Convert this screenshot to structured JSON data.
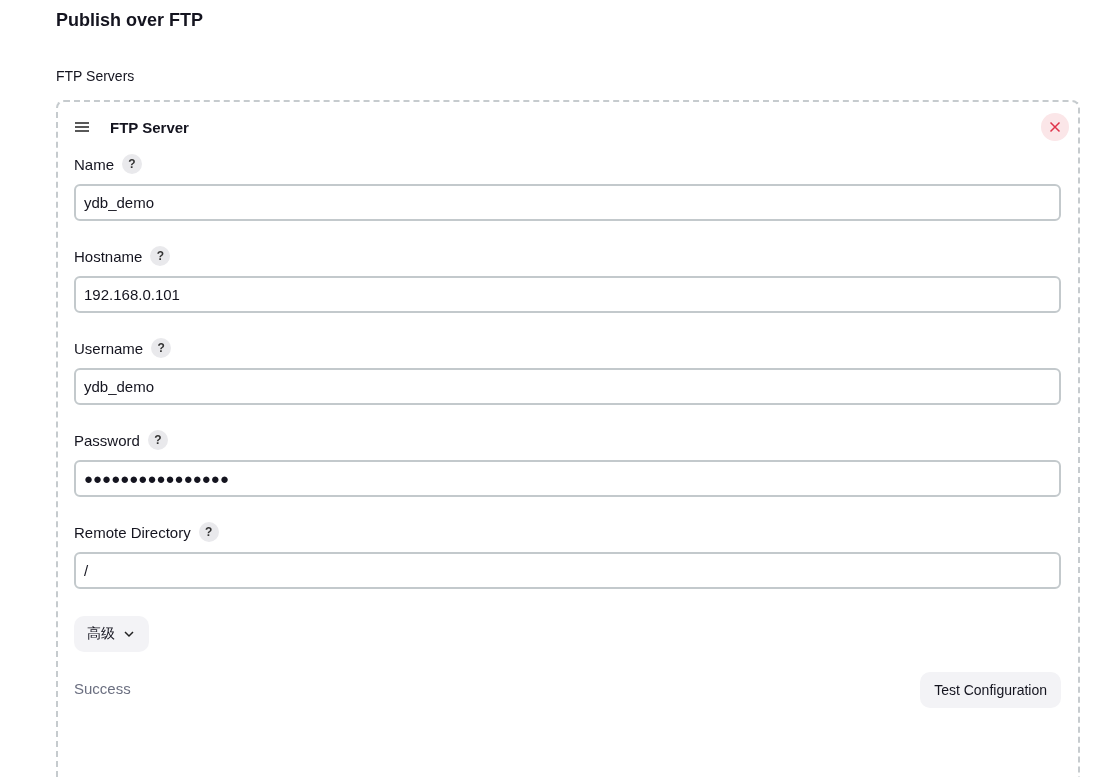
{
  "section": {
    "title": "Publish over FTP"
  },
  "servers_label": "FTP Servers",
  "server": {
    "title": "FTP Server",
    "fields": [
      {
        "label": "Name",
        "help": "?",
        "value": "ydb_demo"
      },
      {
        "label": "Hostname",
        "help": "?",
        "value": "192.168.0.101"
      },
      {
        "label": "Username",
        "help": "?",
        "value": "ydb_demo"
      },
      {
        "label": "Password",
        "help": "?",
        "value": "●●●●●●●●●●●●●●●●"
      },
      {
        "label": "Remote Directory",
        "help": "?",
        "value": "/"
      }
    ],
    "advanced_button": "高级",
    "status": "Success",
    "test_button": "Test Configuration"
  }
}
